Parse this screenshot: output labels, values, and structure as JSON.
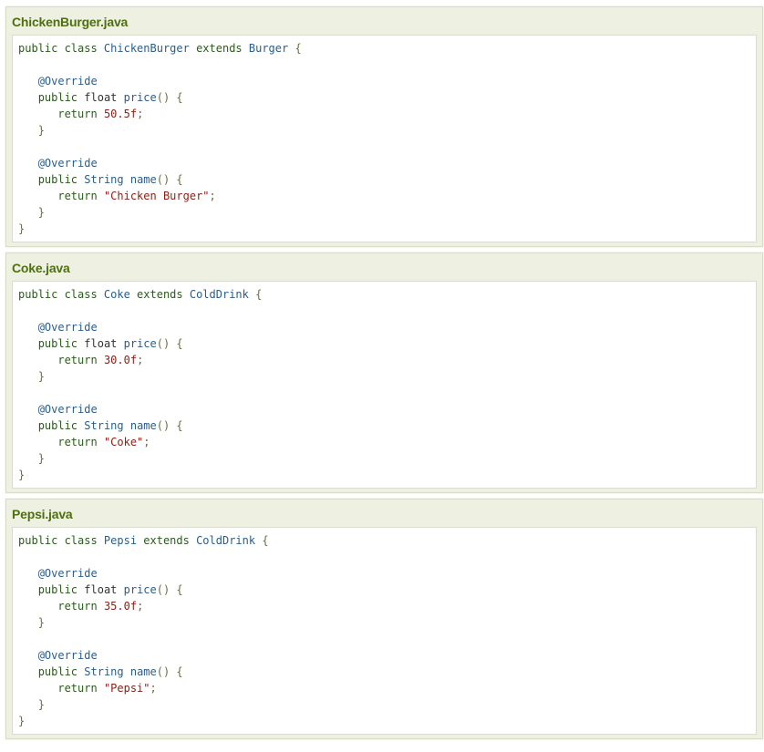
{
  "files": [
    {
      "title": "ChickenBurger.java",
      "lines": [
        [
          [
            "kw",
            "public class "
          ],
          [
            "ty",
            "ChickenBurger "
          ],
          [
            "kw",
            "extends "
          ],
          [
            "ty",
            "Burger "
          ],
          [
            "pn",
            "{"
          ]
        ],
        [],
        [
          [
            "plain",
            "   "
          ],
          [
            "an",
            "@Override"
          ]
        ],
        [
          [
            "plain",
            "   "
          ],
          [
            "kw",
            "public "
          ],
          [
            "plain",
            "float "
          ],
          [
            "ty",
            "price"
          ],
          [
            "pn",
            "() {"
          ]
        ],
        [
          [
            "plain",
            "      "
          ],
          [
            "kw",
            "return "
          ],
          [
            "num",
            "50.5f"
          ],
          [
            "pn",
            ";"
          ]
        ],
        [
          [
            "plain",
            "   "
          ],
          [
            "pn",
            "}"
          ]
        ],
        [],
        [
          [
            "plain",
            "   "
          ],
          [
            "an",
            "@Override"
          ]
        ],
        [
          [
            "plain",
            "   "
          ],
          [
            "kw",
            "public "
          ],
          [
            "ty",
            "String "
          ],
          [
            "ty",
            "name"
          ],
          [
            "pn",
            "() {"
          ]
        ],
        [
          [
            "plain",
            "      "
          ],
          [
            "kw",
            "return "
          ],
          [
            "str",
            "\"Chicken Burger\""
          ],
          [
            "pn",
            ";"
          ]
        ],
        [
          [
            "plain",
            "   "
          ],
          [
            "pn",
            "}"
          ]
        ],
        [
          [
            "pn",
            "}"
          ]
        ]
      ]
    },
    {
      "title": "Coke.java",
      "lines": [
        [
          [
            "kw",
            "public class "
          ],
          [
            "ty",
            "Coke "
          ],
          [
            "kw",
            "extends "
          ],
          [
            "ty",
            "ColdDrink "
          ],
          [
            "pn",
            "{"
          ]
        ],
        [],
        [
          [
            "plain",
            "   "
          ],
          [
            "an",
            "@Override"
          ]
        ],
        [
          [
            "plain",
            "   "
          ],
          [
            "kw",
            "public "
          ],
          [
            "plain",
            "float "
          ],
          [
            "ty",
            "price"
          ],
          [
            "pn",
            "() {"
          ]
        ],
        [
          [
            "plain",
            "      "
          ],
          [
            "kw",
            "return "
          ],
          [
            "num",
            "30.0f"
          ],
          [
            "pn",
            ";"
          ]
        ],
        [
          [
            "plain",
            "   "
          ],
          [
            "pn",
            "}"
          ]
        ],
        [],
        [
          [
            "plain",
            "   "
          ],
          [
            "an",
            "@Override"
          ]
        ],
        [
          [
            "plain",
            "   "
          ],
          [
            "kw",
            "public "
          ],
          [
            "ty",
            "String "
          ],
          [
            "ty",
            "name"
          ],
          [
            "pn",
            "() {"
          ]
        ],
        [
          [
            "plain",
            "      "
          ],
          [
            "kw",
            "return "
          ],
          [
            "str",
            "\"Coke\""
          ],
          [
            "pn",
            ";"
          ]
        ],
        [
          [
            "plain",
            "   "
          ],
          [
            "pn",
            "}"
          ]
        ],
        [
          [
            "pn",
            "}"
          ]
        ]
      ]
    },
    {
      "title": "Pepsi.java",
      "lines": [
        [
          [
            "kw",
            "public class "
          ],
          [
            "ty",
            "Pepsi "
          ],
          [
            "kw",
            "extends "
          ],
          [
            "ty",
            "ColdDrink "
          ],
          [
            "pn",
            "{"
          ]
        ],
        [],
        [
          [
            "plain",
            "   "
          ],
          [
            "an",
            "@Override"
          ]
        ],
        [
          [
            "plain",
            "   "
          ],
          [
            "kw",
            "public "
          ],
          [
            "plain",
            "float "
          ],
          [
            "ty",
            "price"
          ],
          [
            "pn",
            "() {"
          ]
        ],
        [
          [
            "plain",
            "      "
          ],
          [
            "kw",
            "return "
          ],
          [
            "num",
            "35.0f"
          ],
          [
            "pn",
            ";"
          ]
        ],
        [
          [
            "plain",
            "   "
          ],
          [
            "pn",
            "}"
          ]
        ],
        [],
        [
          [
            "plain",
            "   "
          ],
          [
            "an",
            "@Override"
          ]
        ],
        [
          [
            "plain",
            "   "
          ],
          [
            "kw",
            "public "
          ],
          [
            "ty",
            "String "
          ],
          [
            "ty",
            "name"
          ],
          [
            "pn",
            "() {"
          ]
        ],
        [
          [
            "plain",
            "      "
          ],
          [
            "kw",
            "return "
          ],
          [
            "str",
            "\"Pepsi\""
          ],
          [
            "pn",
            ";"
          ]
        ],
        [
          [
            "plain",
            "   "
          ],
          [
            "pn",
            "}"
          ]
        ],
        [
          [
            "pn",
            "}"
          ]
        ]
      ]
    }
  ],
  "colors": {
    "title": "#4f6f10",
    "panel_bg": "#eef1e2",
    "panel_border": "#d7dcc6",
    "keyword": "#2c5a1e",
    "type": "#2b5d8a",
    "literal": "#8b2118",
    "punctuation": "#6c6c3f"
  }
}
